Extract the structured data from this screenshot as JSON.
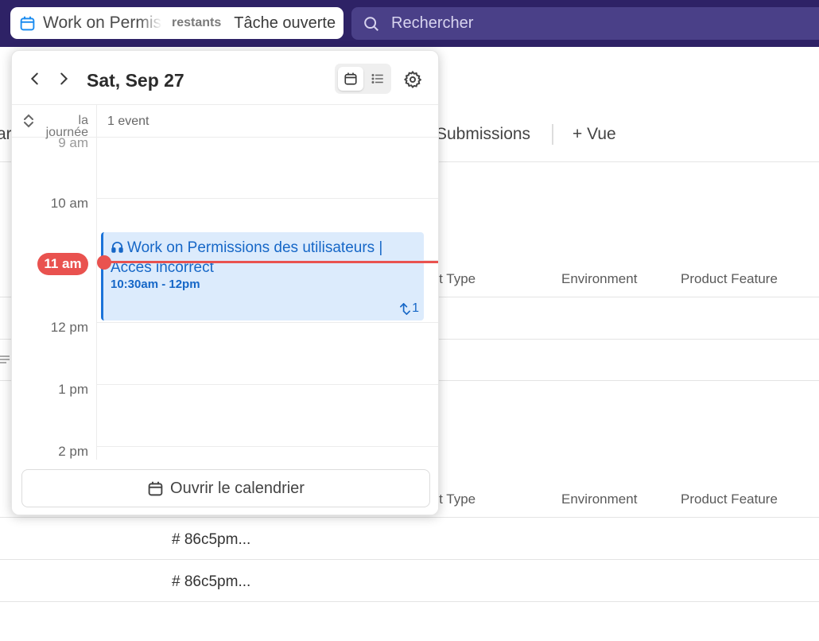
{
  "topbar": {
    "task_title": "Work on Permissions des utilisateurs | Accès incorrect",
    "task_meta": "restants",
    "task_status": "Tâche ouverte",
    "search_placeholder": "Rechercher"
  },
  "background": {
    "tab_left": "ar",
    "tab_submissions": "Submissions",
    "tab_add": "+ Vue",
    "columns": [
      "ort Type",
      "Environment",
      "Product Feature"
    ],
    "rows": [
      "# 86c5pm...",
      "# 86c5pm..."
    ]
  },
  "popover": {
    "date": "Sat, Sep 27",
    "allday_label": "la journée",
    "event_count": "1 event",
    "times": [
      "9 am",
      "10 am",
      "11 am",
      "12 pm",
      "1 pm",
      "2 pm"
    ],
    "now_label": "11 am",
    "event": {
      "title": "Work on Permissions des utilisateurs | Accès incorrect",
      "time": "10:30am - 12pm",
      "sync_count": "1"
    },
    "open_calendar": "Ouvrir le calendrier"
  },
  "colors": {
    "topbar": "#2e2266",
    "search": "#4a4088",
    "event_bg": "#dcebfc",
    "event_accent": "#1667c7",
    "now": "#e9524f"
  }
}
